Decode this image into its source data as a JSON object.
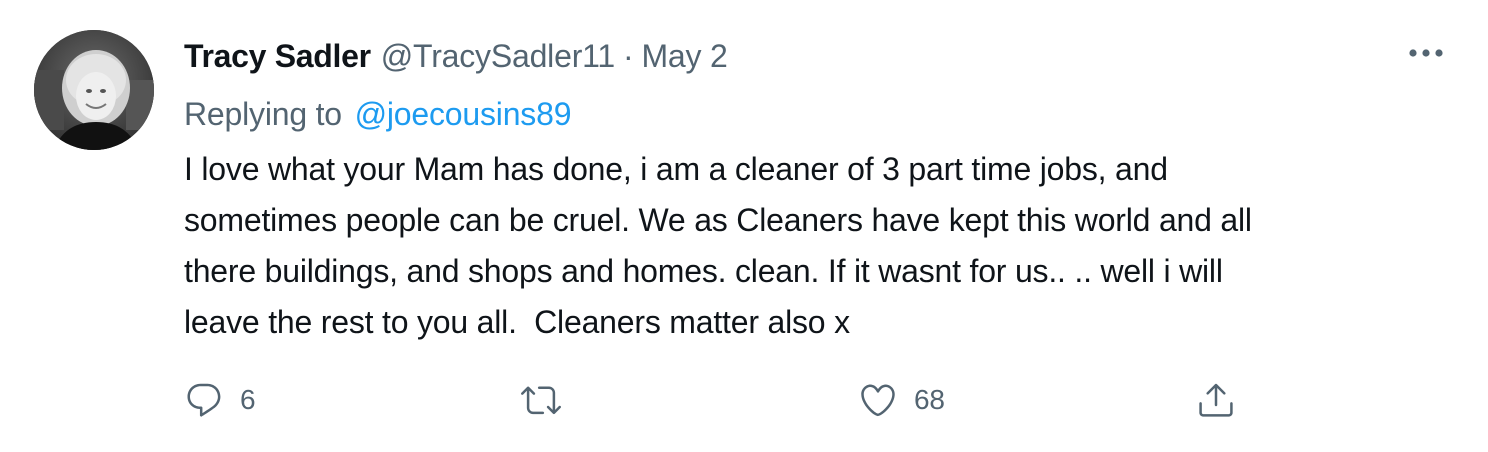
{
  "tweet": {
    "author": {
      "name": "Tracy Sadler",
      "handle": "@TracySadler11",
      "separator": "·",
      "date": "May 2",
      "avatar_icon": "profile-photo"
    },
    "replying": {
      "prefix": "Replying to",
      "mention": "@joecousins89"
    },
    "text": "I love what your Mam has done, i am a cleaner of 3 part time jobs, and\nsometimes people can be cruel. We as Cleaners have kept this world and all\nthere buildings, and shops and homes. clean. If it wasnt for us.. .. well i will\nleave the rest to you all.  Cleaners matter also x",
    "more_icon": "ellipsis-icon",
    "actions": {
      "reply": {
        "icon": "comment-icon",
        "count": "6"
      },
      "retweet": {
        "icon": "retweet-icon",
        "count": ""
      },
      "like": {
        "icon": "heart-icon",
        "count": "68"
      },
      "share": {
        "icon": "share-icon",
        "count": ""
      }
    }
  },
  "colors": {
    "text_primary": "#0f1419",
    "text_secondary": "#536471",
    "link": "#1d9bf0",
    "background": "#ffffff"
  }
}
